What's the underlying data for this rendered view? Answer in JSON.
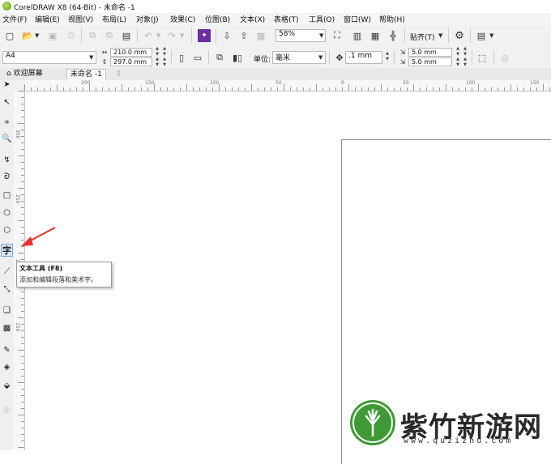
{
  "window": {
    "title": "CorelDRAW X8 (64-Bit) - 未命名 -1"
  },
  "menu": [
    "文件(F)",
    "编辑(E)",
    "视图(V)",
    "布局(L)",
    "对象(J)",
    "效果(C)",
    "位图(B)",
    "文本(X)",
    "表格(T)",
    "工具(O)",
    "窗口(W)",
    "帮助(H)"
  ],
  "toolbar": {
    "zoom_value": "58%",
    "snap_label": "贴齐(T)"
  },
  "property_bar": {
    "page_size": "A4",
    "width": "210.0 mm",
    "height": "297.0 mm",
    "units_label": "单位:",
    "units_value": "毫米",
    "nudge": ".1 mm",
    "dup_x": "5.0 mm",
    "dup_y": "5.0 mm"
  },
  "tabs": {
    "welcome": "欢迎屏幕",
    "document": "未命名 -1"
  },
  "rulers": {
    "h_labels": [
      "200",
      "150",
      "100",
      "50",
      "0",
      "50",
      "100",
      "150"
    ],
    "v_labels": [
      "300",
      "250",
      "200",
      "150"
    ]
  },
  "toolbox": {
    "text_tool_glyph": "字"
  },
  "tooltip": {
    "title": "文本工具 (F8)",
    "description": "添加和编辑段落和美术字。"
  },
  "watermark": {
    "name": "紫竹新游网",
    "url": "www.quzizhu.com"
  },
  "colors": {
    "arrow": "#e53030",
    "active_tool_bg": "#d7e7f7",
    "watermark_green": "#3f9a35"
  }
}
